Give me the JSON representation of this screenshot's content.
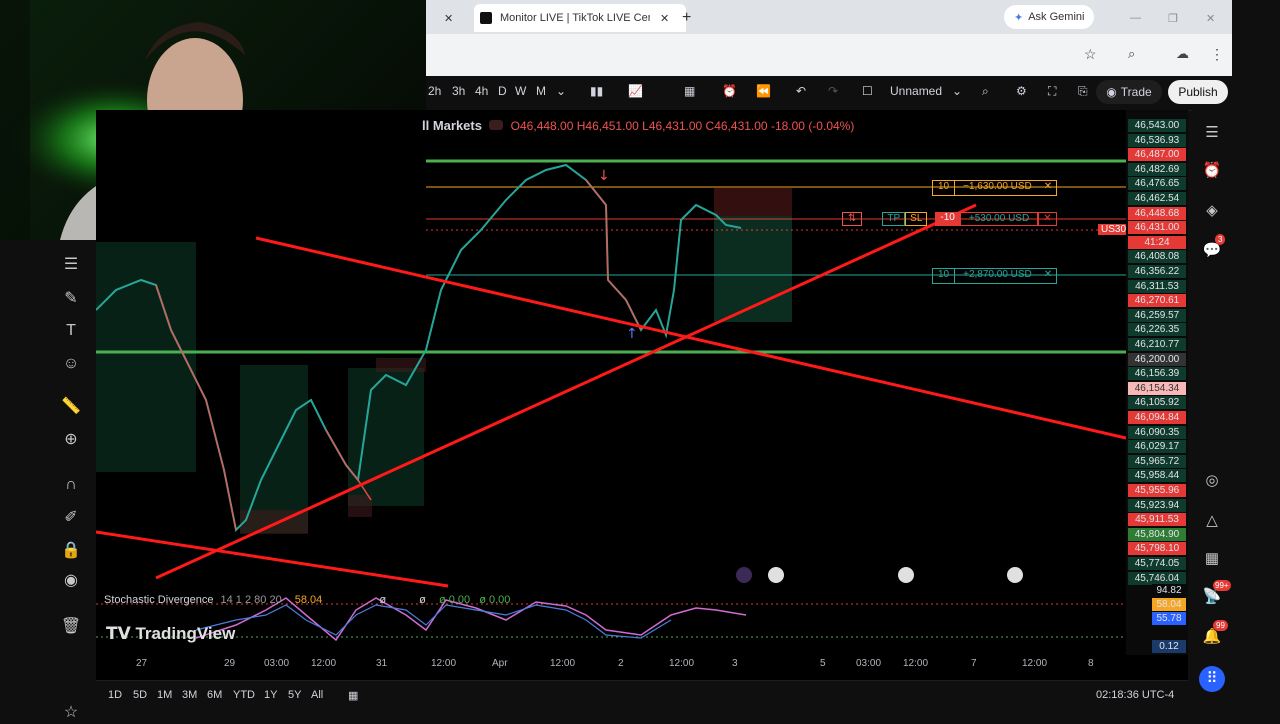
{
  "browser": {
    "tab_title": "Monitor LIVE | TikTok LIVE Cent",
    "ask_gemini": "Ask Gemini"
  },
  "toolbar": {
    "intervals": [
      "2h",
      "3h",
      "4h",
      "D",
      "W",
      "M"
    ],
    "layout_name": "Unnamed",
    "trade_label": "Trade",
    "publish_label": "Publish"
  },
  "symbol": {
    "name": "ll Markets",
    "ohlc": {
      "open": "O46,448.00",
      "high": "H46,451.00",
      "low": "L46,431.00",
      "close": "C46,431.00",
      "change": "-18.00 (-0.04%)"
    }
  },
  "positions": {
    "stop": {
      "qty": "10",
      "pnl": "−1,630.00 USD"
    },
    "entry": {
      "qty": "-10",
      "pnl": "+530.00 USD",
      "tp": "TP",
      "sl": "SL"
    },
    "target": {
      "qty": "10",
      "pnl": "+2,870.00 USD"
    }
  },
  "price_scale": {
    "labels": [
      "46,543.00",
      "46,536.93",
      "46,487.00",
      "46,482.69",
      "46,476.65",
      "46,462.54",
      "46,448.68",
      "46,431.00",
      "41:24",
      "46,408.08",
      "46,356.22",
      "46,311.53",
      "46,270.61",
      "46,259.57",
      "46,226.35",
      "46,210.77",
      "46,200.00",
      "46,156.39",
      "46,154.34",
      "46,105.92",
      "46,094.84",
      "46,090.35",
      "46,029.17",
      "45,965.72",
      "45,958.44",
      "45,955.96",
      "45,923.94",
      "45,911.53",
      "45,804.90",
      "45,798.10",
      "45,774.05",
      "45,746.04"
    ],
    "symbol_tag": "US30",
    "osc_labels": [
      "94.82",
      "58.04",
      "55.78",
      "0.12"
    ]
  },
  "indicator": {
    "name": "Stochastic Divergence",
    "params": "14 1 2 80 20",
    "value1": "58.04",
    "value2": "ø",
    "value3": "ø",
    "value4": "ø 0.00",
    "value5": "ø 0.00"
  },
  "watermark": "TradingView",
  "time_axis": [
    "27",
    "29",
    "03:00",
    "12:00",
    "31",
    "12:00",
    "Apr",
    "12:00",
    "2",
    "12:00",
    "3",
    "5",
    "03:00",
    "12:00",
    "7",
    "12:00",
    "8"
  ],
  "ranges": [
    "1D",
    "5D",
    "1M",
    "3M",
    "6M",
    "YTD",
    "1Y",
    "5Y",
    "All"
  ],
  "clock": "02:18:36 UTC-4",
  "badges": {
    "alerts": "3",
    "ideas": "99+",
    "notifications": "99"
  }
}
